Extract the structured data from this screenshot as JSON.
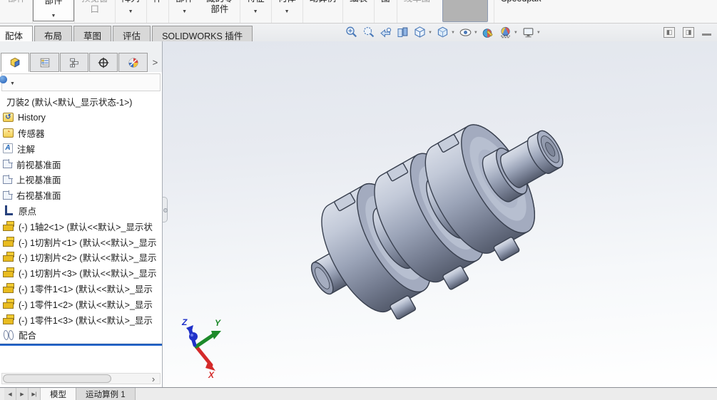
{
  "ribbon": {
    "items": [
      {
        "label": "部件",
        "disabled": true
      },
      {
        "label": "部件",
        "boxed": true
      },
      {
        "lines": [
          "预览窗",
          "口"
        ],
        "disabled": true
      },
      {
        "label": "阵列",
        "caret": true
      },
      {
        "label": "件"
      },
      {
        "label": "部件",
        "caret": true
      },
      {
        "lines": [
          "藏的零",
          "部件"
        ]
      },
      {
        "label": "特征",
        "caret": true
      },
      {
        "label": "何体",
        "caret": true
      },
      {
        "label": "动算例"
      },
      {
        "label": "细表"
      },
      {
        "label": "图"
      },
      {
        "label": "线单图",
        "disabled": true
      },
      {
        "label": "Speedpak"
      }
    ]
  },
  "command_tabs": [
    {
      "label": "配体",
      "active": true
    },
    {
      "label": "布局"
    },
    {
      "label": "草图"
    },
    {
      "label": "评估"
    },
    {
      "label": "SOLIDWORKS 插件"
    }
  ],
  "headsup": {
    "icons": [
      "zoom-to-fit",
      "zoom-to-area",
      "previous-view",
      "section-view",
      "view-orientation",
      "display-style",
      "hide-show-items",
      "edit-appearance",
      "apply-scene",
      "view-settings"
    ]
  },
  "panel": {
    "tabs": [
      "featuremanager-design-tree",
      "propertymanager",
      "configurationmanager",
      "dimxpertmanager",
      "displaymanager"
    ],
    "tree": {
      "root": "刀装2  (默认<默认_显示状态-1>)",
      "items": [
        {
          "icon": "history-folder",
          "label": "History"
        },
        {
          "icon": "sensors-folder",
          "label": "传感器"
        },
        {
          "icon": "annotations",
          "label": "注解"
        },
        {
          "icon": "plane",
          "label": "前视基准面"
        },
        {
          "icon": "plane",
          "label": "上视基准面"
        },
        {
          "icon": "plane",
          "label": "右视基准面"
        },
        {
          "icon": "origin",
          "label": "原点"
        },
        {
          "icon": "part",
          "label": "(-) 1轴2<1> (默认<<默认>_显示状"
        },
        {
          "icon": "part",
          "label": "(-) 1切割片<1> (默认<<默认>_显示"
        },
        {
          "icon": "part",
          "label": "(-) 1切割片<2> (默认<<默认>_显示"
        },
        {
          "icon": "part",
          "label": "(-) 1切割片<3> (默认<<默认>_显示"
        },
        {
          "icon": "part",
          "label": "(-) 1零件1<1> (默认<<默认>_显示"
        },
        {
          "icon": "part",
          "label": "(-) 1零件1<2> (默认<<默认>_显示"
        },
        {
          "icon": "part",
          "label": "(-) 1零件1<3> (默认<<默认>_显示"
        },
        {
          "icon": "mates",
          "label": "配合"
        }
      ]
    }
  },
  "viewport": {
    "triad": {
      "x": "X",
      "y": "Y",
      "z": "Z"
    }
  },
  "bottom": {
    "nav": [
      "◀",
      "▶",
      "▶|"
    ],
    "tabs": [
      {
        "label": "模型",
        "active": true
      },
      {
        "label": "运动算例 1"
      }
    ]
  },
  "icons_glyphs": {
    "history": "↺",
    "sensors": "◔",
    "annotations": "A"
  },
  "ui": {
    "caret_down": "▼",
    "chevron_right": "›",
    "panel_expand": ">",
    "pane_left": "◧",
    "pane_right": "◨"
  },
  "colors": {
    "accent_blue": "#2a6ad0",
    "part_yellow": "#f0c420",
    "viewport_top": "#e4e8ee",
    "model_gray": "#9aa3b7",
    "x_axis": "#d42a2a",
    "y_axis": "#1d8a2a",
    "z_axis": "#2031c9"
  }
}
